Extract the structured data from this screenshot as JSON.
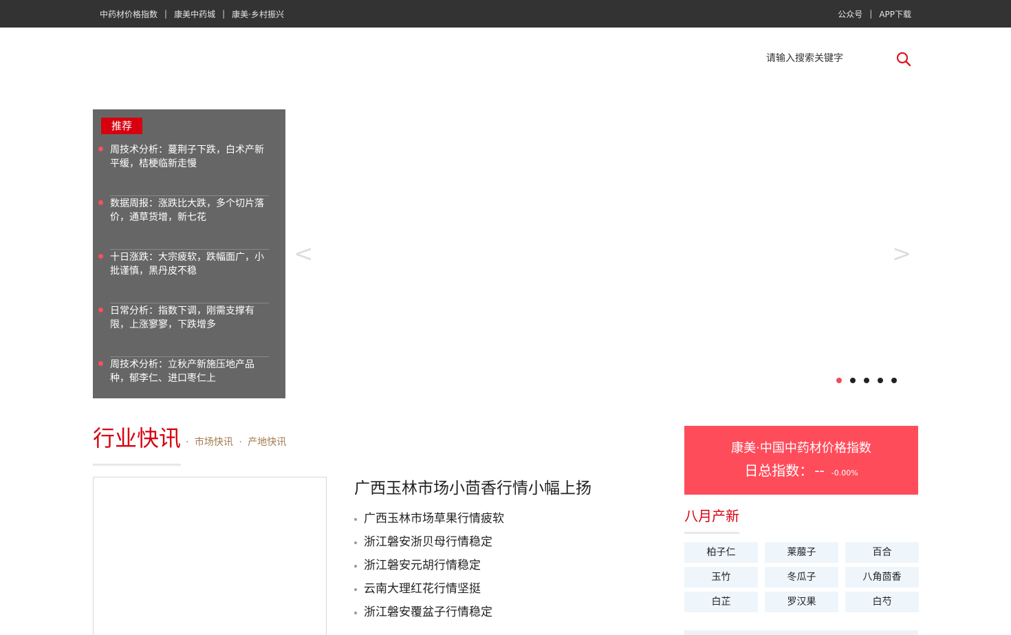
{
  "topbar": {
    "left_links": [
      "中药材价格指数",
      "康美中药城",
      "康美·乡村振兴"
    ],
    "right_links": [
      "公众号",
      "APP下载"
    ],
    "separator": "|"
  },
  "search": {
    "placeholder": "请输入搜索关键字",
    "icon": "search-icon"
  },
  "recommend": {
    "tag": "推荐",
    "items": [
      "周技术分析：蔓荆子下跌，白术产新平缓，桔梗临新走慢",
      "数据周报：涨跌比大跌，多个切片落价，通草货增，新七花",
      "十日涨跌：大宗疲软，跌幅面广，小批谨慎，黑丹皮不稳",
      "日常分析：指数下调，刚需支撑有限，上涨寥寥，下跌增多",
      "周技术分析：立秋产新施压地产品种，郁李仁、进口枣仁上"
    ]
  },
  "carousel": {
    "prev": "<",
    "next": ">",
    "dot_count": 5,
    "active_index": 0
  },
  "industry_news": {
    "title": "行业快讯",
    "sub_links": [
      "·",
      "市场快讯",
      "·",
      "产地快讯"
    ],
    "headline": "广西玉林市场小茴香行情小幅上扬",
    "items": [
      "广西玉林市场草果行情疲软",
      "浙江磐安浙贝母行情稳定",
      "浙江磐安元胡行情稳定",
      "云南大理红花行情坚挺",
      "浙江磐安覆盆子行情稳定"
    ]
  },
  "index_box": {
    "title": "康美·中国中药材价格指数",
    "label": "日总指数：",
    "value": "--",
    "change": "-0.00%"
  },
  "august_new": {
    "title": "八月产新",
    "herbs": [
      "柏子仁",
      "莱菔子",
      "百合",
      "玉竹",
      "冬瓜子",
      "八角茴香",
      "白芷",
      "罗汉果",
      "白芍"
    ]
  },
  "colors": {
    "topbar_bg": "#333333",
    "accent_red": "#d7000f",
    "index_bg": "#ff4c5b",
    "recommend_bg": "#666666",
    "herb_bg": "#eef5fb"
  }
}
